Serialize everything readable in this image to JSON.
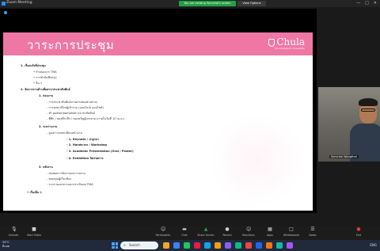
{
  "window": {
    "title": "Zoom Meeting",
    "share_banner": "You are viewing Somchai's screen",
    "view_options": "View Options",
    "controls": [
      "—",
      "□",
      "✕"
    ]
  },
  "slide": {
    "title": "วาระการประชุม",
    "logo_text": "Chula",
    "logo_tag": "Chulalongkorn University",
    "lines": [
      {
        "num": "1.",
        "text": "เรื่องแจ้งที่ประชุม"
      },
      {
        "bullet": "•",
        "text": "กำหนดการ TMA"
      },
      {
        "bullet": "•",
        "text": "การทำบันทึกสรุป"
      },
      {
        "bullet": "•",
        "text": "อื่น ๆ"
      },
      {
        "num": "2.",
        "text": "จัดการงานด้านสื่อสาร/ประชาสัมพันธ์"
      },
      {
        "num": "1.",
        "text": "ก่อนงาน"
      },
      {
        "text": "- การประชาสัมพันธ์งานผ่านช่องทางต่างๆ"
      },
      {
        "text": "- การลงทะเบียนผู้เข้าร่วม (ออนไลน์/ ออนไซต์)"
      },
      {
        "text": "- ทำ poster/pamphlet ประชาสัมพันธ์"
      },
      {
        "text": "- ที่พัก / ของที่ระลึก / ของขวัญผู้บรรยาย (ภายในวันที่ 10 เม.ย.)"
      },
      {
        "num": "2.",
        "text": "ระหว่างงาน"
      },
      {
        "text": "- ดูแลการลงทะเบียนหน้างาน"
      },
      {
        "text": "- 1. Keynote / ปาฐกถา"
      },
      {
        "text": "- 2. Hands-on / Workshop"
      },
      {
        "text": "- 3. Academic Presentation (Oral / Poster)"
      },
      {
        "text": "- 4. Exhibition นิทรรศการ"
      },
      {
        "num": "3.",
        "text": "หลังงาน"
      },
      {
        "text": "- สรุปผลการจัดงานและรายงาน"
      },
      {
        "text": "- ขอบคุณผู้เกี่ยวข้อง"
      },
      {
        "text": "- รวบรวมเอกสารและประเมินผล TMA"
      },
      {
        "bullet": "•",
        "text": "เรื่องอื่น ๆ"
      }
    ]
  },
  "speaker": {
    "name": "Somchai Wongthai"
  },
  "toolbar": {
    "left": [
      {
        "icon": "mic-icon",
        "glyph": "🎙",
        "label": "Unmute"
      },
      {
        "icon": "video-icon",
        "glyph": "■",
        "label": "Start Video"
      }
    ],
    "center": [
      {
        "icon": "participants-icon",
        "glyph": "☺",
        "label": "Participants"
      },
      {
        "icon": "chat-icon",
        "glyph": "▬",
        "label": "Chat"
      },
      {
        "icon": "share-screen-icon",
        "glyph": "▲",
        "label": "Share Screen"
      },
      {
        "icon": "record-icon",
        "glyph": "●",
        "label": "Record"
      },
      {
        "icon": "reactions-icon",
        "glyph": "☺",
        "label": "Reactions"
      },
      {
        "icon": "apps-icon",
        "glyph": "▦",
        "label": "Apps"
      },
      {
        "icon": "whiteboard-icon",
        "glyph": "□",
        "label": "Whiteboards"
      },
      {
        "icon": "notes-icon",
        "glyph": "☰",
        "label": "Notes"
      }
    ],
    "end_label": "End"
  },
  "taskbar": {
    "weather_temp": "34°C",
    "weather_text": "มีแดด",
    "search_placeholder": "Search",
    "apps": [
      "#f5a623",
      "#3b82f6",
      "#22c55e",
      "#e11d48",
      "#0ea5e9",
      "#f59e0b",
      "#8b5cf6",
      "#10b981",
      "#ef4444",
      "#2563eb",
      "#f97316",
      "#14b8a6",
      "#a855f7"
    ],
    "tray_text": "ENG"
  }
}
